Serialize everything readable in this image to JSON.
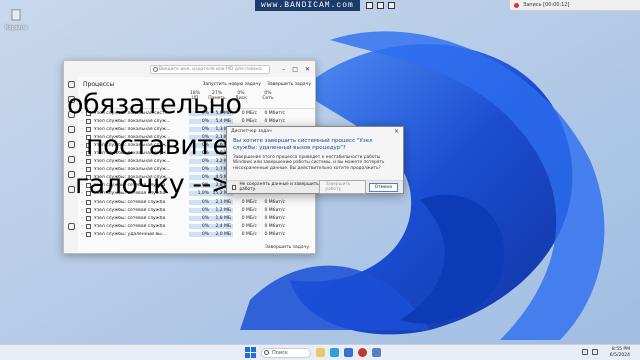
{
  "bandicam": {
    "logo": "www.BANDICAM.com",
    "recording": "Запись [00:00:12]"
  },
  "desktop": {
    "recycle_bin_label": "Корзина"
  },
  "task_manager": {
    "search_placeholder": "Введите имя, издателя или PID для поиска",
    "title": "Процессы",
    "run_new_task": "Запустить новую задачу",
    "end_task": "Завершить задачу",
    "columns": [
      {
        "pct": "18%",
        "label": "ЦП"
      },
      {
        "pct": "27%",
        "label": "Память"
      },
      {
        "pct": "0%",
        "label": "Диск"
      },
      {
        "pct": "0%",
        "label": "Сеть"
      }
    ],
    "rows": [
      {
        "name": "Узел службы: локальная сист...",
        "cpu": "0%",
        "mem": "5,8 МБ",
        "disk": "0 МБ/с",
        "net": "0 Мбит/с"
      },
      {
        "name": "Узел службы: локальная служ...",
        "cpu": "0%",
        "mem": "5,4 МБ",
        "disk": "0 МБ/с",
        "net": "0 Мбит/с"
      },
      {
        "name": "Узел службы: локальная служ...",
        "cpu": "0%",
        "mem": "1,3 МБ",
        "disk": "0 МБ/с",
        "net": "0 Мбит/с"
      },
      {
        "name": "Узел службы: локальная служ...",
        "cpu": "0%",
        "mem": "2,1 МБ",
        "disk": "0 МБ/с",
        "net": "0 Мбит/с"
      },
      {
        "name": "Узел службы: локальная служ...",
        "cpu": "0%",
        "mem": "1,6 МБ",
        "disk": "0 МБ/с",
        "net": "0 Мбит/с"
      },
      {
        "name": "Узел службы: локальная служ...",
        "cpu": "0%",
        "mem": "2,0 МБ",
        "disk": "0 МБ/с",
        "net": "0 Мбит/с"
      },
      {
        "name": "Узел службы: локальная служ...",
        "cpu": "0%",
        "mem": "3,2 МБ",
        "disk": "0 МБ/с",
        "net": "0 Мбит/с"
      },
      {
        "name": "Узел службы: локальная служ...",
        "cpu": "0%",
        "mem": "1,7 МБ",
        "disk": "0 МБ/с",
        "net": "0 Мбит/с"
      },
      {
        "name": "Узел службы: локальная служ...",
        "cpu": "0%",
        "mem": "4,5 МБ",
        "disk": "0 МБ/с",
        "net": "0 Мбит/с"
      },
      {
        "name": "Узел службы: сетевая служба",
        "cpu": "0%",
        "mem": "2,8 МБ",
        "disk": "0 МБ/с",
        "net": "0 Мбит/с"
      },
      {
        "name": "Узел службы: сетевая служба",
        "cpu": "1,0%",
        "mem": "15,2 МБ",
        "disk": "0 МБ/с",
        "net": "0 Мбит/с"
      },
      {
        "name": "Узел службы: сетевая служба",
        "cpu": "0%",
        "mem": "2,1 МБ",
        "disk": "0 МБ/с",
        "net": "0 Мбит/с"
      },
      {
        "name": "Узел службы: сетевая служба",
        "cpu": "0%",
        "mem": "1,2 МБ",
        "disk": "0 МБ/с",
        "net": "0 Мбит/с"
      },
      {
        "name": "Узел службы: сетевая служба",
        "cpu": "0%",
        "mem": "1,8 МБ",
        "disk": "0 МБ/с",
        "net": "0 Мбит/с"
      },
      {
        "name": "Узел службы: сетевая служба",
        "cpu": "0%",
        "mem": "2,4 МБ",
        "disk": "0 МБ/с",
        "net": "0 Мбит/с"
      },
      {
        "name": "Узел службы: удаленный вы...",
        "cpu": "0%",
        "mem": "2,0 МБ",
        "disk": "0 МБ/с",
        "net": "0 Мбит/с"
      }
    ]
  },
  "dialog": {
    "title": "Диспетчер задач",
    "question": "Вы хотите завершить системный процесс \"Узел службы: удаленный вызов процедур\"?",
    "warning": "Завершение этого процесса приведет к нестабильности работы Windows или завершению работы системы, и вы можете потерять несохраненные данные. Вы действительно хотите продолжить?",
    "checkbox_label": "Не сохранять данные и завершить работу.",
    "confirm_button": "Завершить работу",
    "cancel_button": "Отмена"
  },
  "overlay": {
    "line1": "обязательно",
    "line2": "поставите",
    "line3": "галочку -->"
  },
  "taskbar": {
    "search_label": "Поиск",
    "time": "8:55 PM",
    "date": "6/5/2024"
  }
}
